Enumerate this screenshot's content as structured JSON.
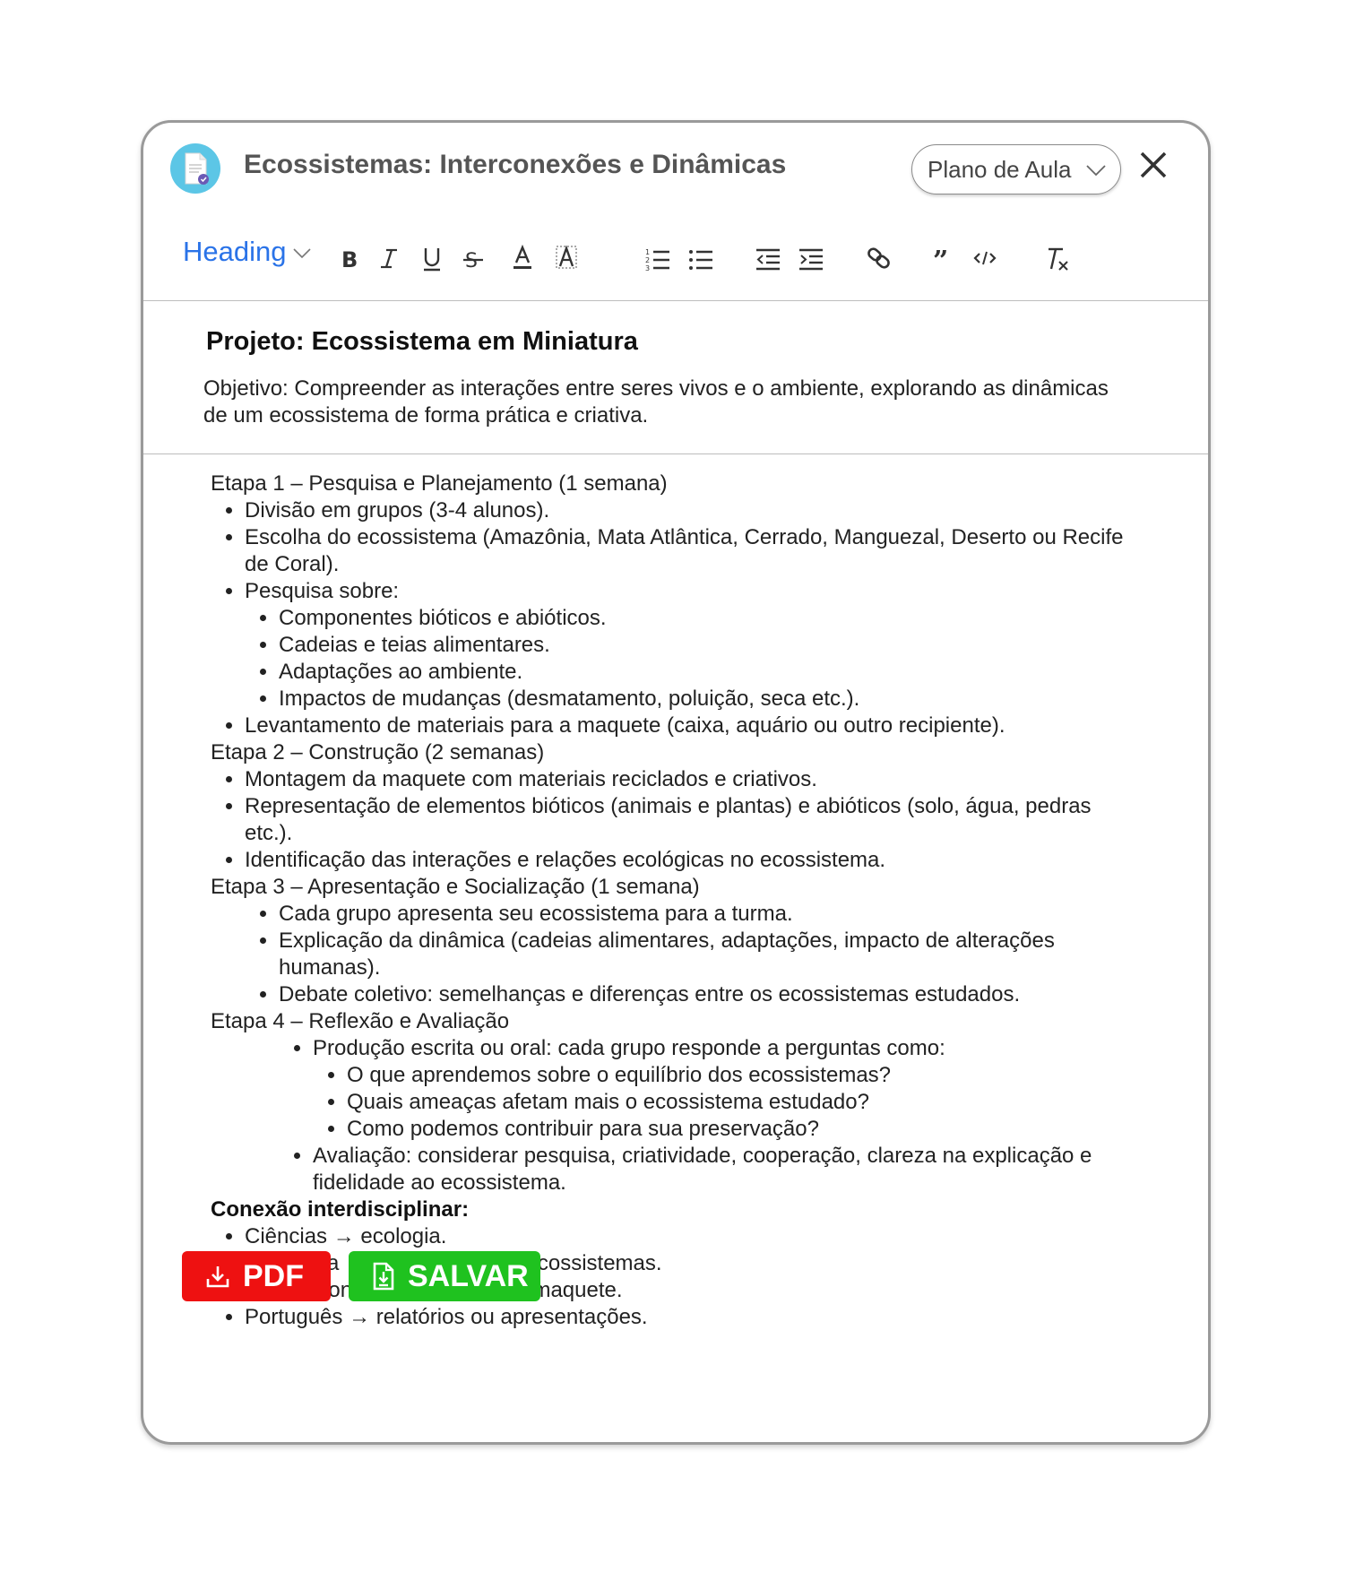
{
  "window": {
    "title": "Ecossistemas: Interconexões e Dinâmicas",
    "doc_type_select": "Plano de Aula"
  },
  "toolbar": {
    "heading_label": "Heading"
  },
  "document": {
    "project_title": "Projeto: Ecossistema em Miniatura",
    "objective": "Objetivo: Compreender as interações entre seres vivos e o ambiente, explorando as dinâmicas de um ecossistema de forma prática e criativa.",
    "stage1": {
      "title": "Etapa 1 – Pesquisa e Planejamento (1 semana)",
      "items": [
        "Divisão em grupos (3-4 alunos).",
        "Escolha do ecossistema (Amazônia, Mata Atlântica, Cerrado, Manguezal, Deserto ou Recife de Coral).",
        "Pesquisa sobre:"
      ],
      "subitems": [
        "Componentes bióticos e abióticos.",
        "Cadeias e teias alimentares.",
        "Adaptações ao ambiente.",
        "Impactos de mudanças (desmatamento, poluição, seca etc.)."
      ],
      "last_item": "Levantamento de materiais para a maquete (caixa, aquário ou outro recipiente)."
    },
    "stage2": {
      "title": "Etapa 2 – Construção (2 semanas)",
      "items": [
        "Montagem da maquete com materiais reciclados e criativos.",
        "Representação de elementos bióticos (animais e plantas) e abióticos (solo, água, pedras etc.).",
        "Identificação das interações e relações ecológicas no ecossistema."
      ]
    },
    "stage3": {
      "title": "Etapa 3 – Apresentação e Socialização (1 semana)",
      "items": [
        "Cada grupo apresenta seu ecossistema para a turma.",
        "Explicação da dinâmica (cadeias alimentares, adaptações, impacto de alterações humanas).",
        "Debate coletivo: semelhanças e diferenças entre os ecossistemas estudados."
      ]
    },
    "stage4": {
      "title": "Etapa 4 – Reflexão e Avaliação",
      "item1": "Produção escrita ou oral: cada grupo responde a perguntas como:",
      "questions": [
        "O que aprendemos sobre o equilíbrio dos ecossistemas?",
        "Quais ameaças afetam mais o ecossistema estudado?",
        "Como podemos contribuir para sua preservação?"
      ],
      "item2": "Avaliação: considerar pesquisa, criatividade, cooperação, clareza na explicação e fidelidade ao ecossistema."
    },
    "interdisciplinary": {
      "title": "Conexão interdisciplinar:",
      "items": [
        "Ciências → ecologia.",
        "Geografia → localização dos ecossistemas.",
        "Arte → construção criativa da maquete.",
        "Português → relatórios ou apresentações."
      ]
    }
  },
  "actions": {
    "pdf_label": "PDF",
    "save_label": "SALVAR"
  },
  "colors": {
    "pdf": "#ee1111",
    "save": "#1fc21f",
    "heading_accent": "#2a73e8",
    "icon_bg": "#5cc6e6"
  }
}
